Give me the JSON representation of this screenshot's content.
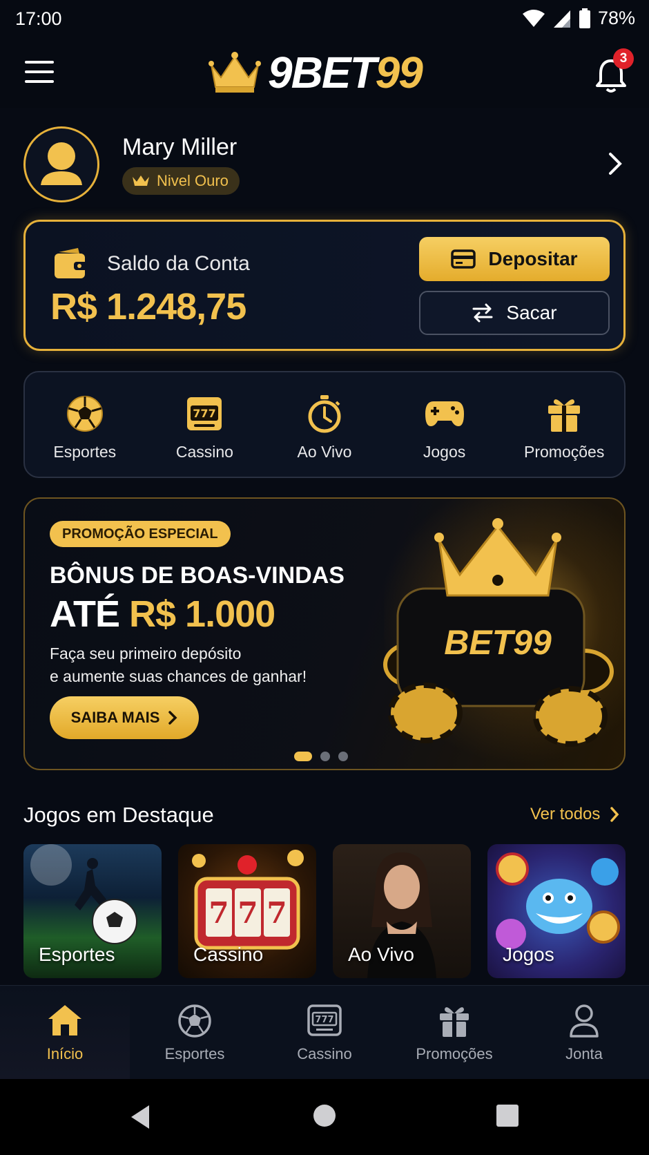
{
  "status_bar": {
    "time": "17:00",
    "battery": "78%"
  },
  "header": {
    "logo_part1": "9BET",
    "logo_part2": "99",
    "notifications_count": "3"
  },
  "profile": {
    "name": "Mary Miller",
    "level": "Nivel Ouro"
  },
  "balance": {
    "label": "Saldo da Conta",
    "value": "R$ 1.248,75",
    "deposit_label": "Depositar",
    "withdraw_label": "Sacar"
  },
  "categories": [
    {
      "label": "Esportes",
      "icon": "soccer-ball-icon"
    },
    {
      "label": "Cassino",
      "icon": "slot-machine-icon"
    },
    {
      "label": "Ao Vivo",
      "icon": "stopwatch-icon"
    },
    {
      "label": "Jogos",
      "icon": "gamepad-icon"
    },
    {
      "label": "Promoções",
      "icon": "gift-icon"
    }
  ],
  "promo": {
    "tag": "PROMOÇÃO ESPECIAL",
    "headline1": "BÔNUS DE BOAS-VINDAS",
    "headline2_prefix": "ATÉ",
    "headline2_amount": "R$ 1.000",
    "desc_line1": "Faça seu primeiro depósito",
    "desc_line2": "e aumente suas chances de ganhar!",
    "cta": "SAIBA MAIS",
    "art_logo": "BET99",
    "slides_total": 3,
    "slide_active": 1
  },
  "featured": {
    "title": "Jogos em Destaque",
    "see_all": "Ver todos",
    "games": [
      {
        "label": "Esportes"
      },
      {
        "label": "Cassino"
      },
      {
        "label": "Ao Vivo"
      },
      {
        "label": "Jogos"
      }
    ]
  },
  "bottom_nav": [
    {
      "label": "Início",
      "icon": "home-icon",
      "active": true
    },
    {
      "label": "Esportes",
      "icon": "soccer-ball-icon",
      "active": false
    },
    {
      "label": "Cassino",
      "icon": "slot-machine-icon",
      "active": false
    },
    {
      "label": "Promoções",
      "icon": "gift-icon",
      "active": false
    },
    {
      "label": "Jonta",
      "icon": "user-icon",
      "active": false
    }
  ],
  "colors": {
    "accent": "#f2c14e",
    "background": "#070b14",
    "badge": "#e0222a"
  }
}
